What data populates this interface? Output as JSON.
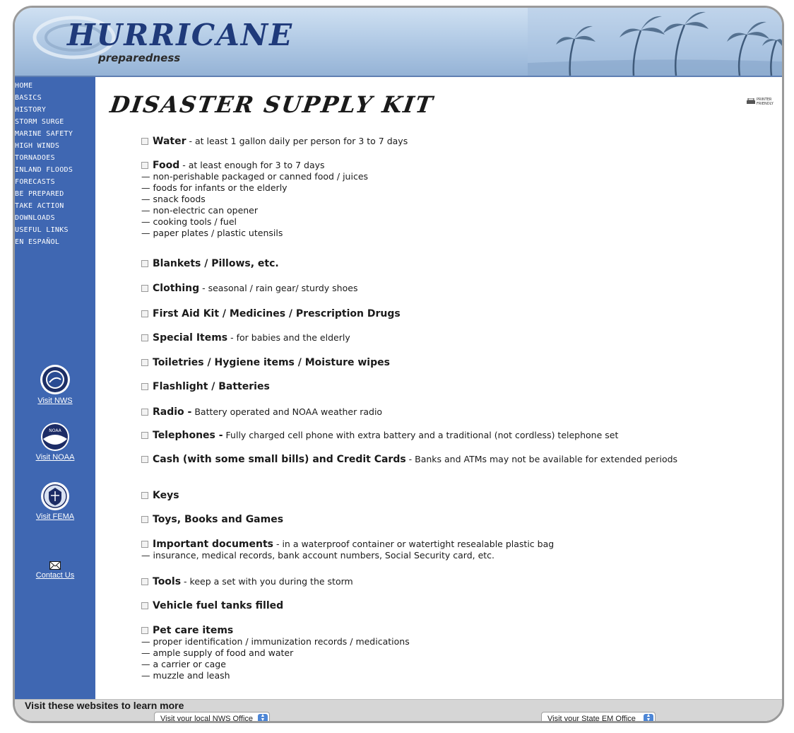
{
  "header": {
    "logo_title": "HURRICANE",
    "logo_subtitle": "preparedness"
  },
  "sidebar": {
    "nav": [
      "HOME",
      "BASICS",
      "HISTORY",
      "STORM SURGE",
      "MARINE SAFETY",
      "HIGH WINDS",
      "TORNADOES",
      "INLAND FLOODS",
      "FORECASTS",
      "BE PREPARED",
      "TAKE ACTION",
      "DOWNLOADS",
      "USEFUL LINKS",
      "EN ESPAÑOL"
    ],
    "links": {
      "nws": "Visit NWS",
      "noaa": "Visit NOAA",
      "fema": "Visit FEMA",
      "contact": "Contact Us"
    },
    "seal_text": {
      "noaa": "NOAA"
    }
  },
  "content": {
    "title": "DISASTER SUPPLY KIT",
    "printer_label": "PRINTER FRIENDLY",
    "items": [
      {
        "title": "Water",
        "desc": " - at least 1 gallon daily per person for 3 to 7 days"
      },
      {
        "title": "Food",
        "desc": " - at least enough for 3 to 7 days",
        "subs": [
          "— non-perishable packaged or canned food / juices",
          "— foods for infants or the elderly",
          "— snack foods",
          "— non-electric can opener",
          "— cooking tools / fuel",
          "— paper plates / plastic utensils"
        ]
      },
      {
        "title": "Blankets / Pillows, etc.",
        "desc": ""
      },
      {
        "title": "Clothing",
        "desc": " - seasonal / rain gear/ sturdy shoes"
      },
      {
        "title": "First Aid Kit / Medicines / Prescription Drugs",
        "desc": ""
      },
      {
        "title": "Special Items",
        "desc": " - for babies and the elderly"
      },
      {
        "title": "Toiletries / Hygiene items / Moisture wipes",
        "desc": ""
      },
      {
        "title": "Flashlight / Batteries",
        "desc": ""
      },
      {
        "title": "Radio -",
        "desc": " Battery operated and NOAA weather radio"
      },
      {
        "title": "Telephones -",
        "desc": " Fully charged cell phone with extra battery and a traditional (not cordless) telephone set"
      },
      {
        "title": "Cash (with some small bills) and Credit Cards",
        "desc": " - Banks and ATMs may not be available for extended periods"
      },
      {
        "title": "Keys",
        "desc": ""
      },
      {
        "title": "Toys, Books and Games",
        "desc": ""
      },
      {
        "title": "Important documents",
        "desc": " - in a waterproof container or watertight resealable plastic bag",
        "subs": [
          "— insurance, medical records, bank account numbers, Social Security card, etc."
        ]
      },
      {
        "title": "Tools",
        "desc": " - keep a set with you during the storm"
      },
      {
        "title": "Vehicle fuel tanks filled",
        "desc": ""
      },
      {
        "title": "Pet care items",
        "desc": "",
        "subs": [
          "— proper identification / immunization records / medications",
          "— ample supply of food and water",
          "— a carrier or cage",
          "— muzzle and leash"
        ]
      }
    ]
  },
  "footer": {
    "title": "Visit these websites to learn more",
    "select_nws": "Visit your local NWS Office",
    "select_em": "Visit your State EM Office"
  },
  "colors": {
    "sidebar": "#3f67b2",
    "header_top": "#cfe0f2",
    "header_bottom": "#95b3d6",
    "footer": "#d6d6d6"
  },
  "icons": [
    "nws-seal-icon",
    "noaa-logo-icon",
    "fema-seal-icon",
    "envelope-icon",
    "printer-icon",
    "palm-trees-icon",
    "logo-swirl-icon",
    "stepper-arrows-icon"
  ]
}
